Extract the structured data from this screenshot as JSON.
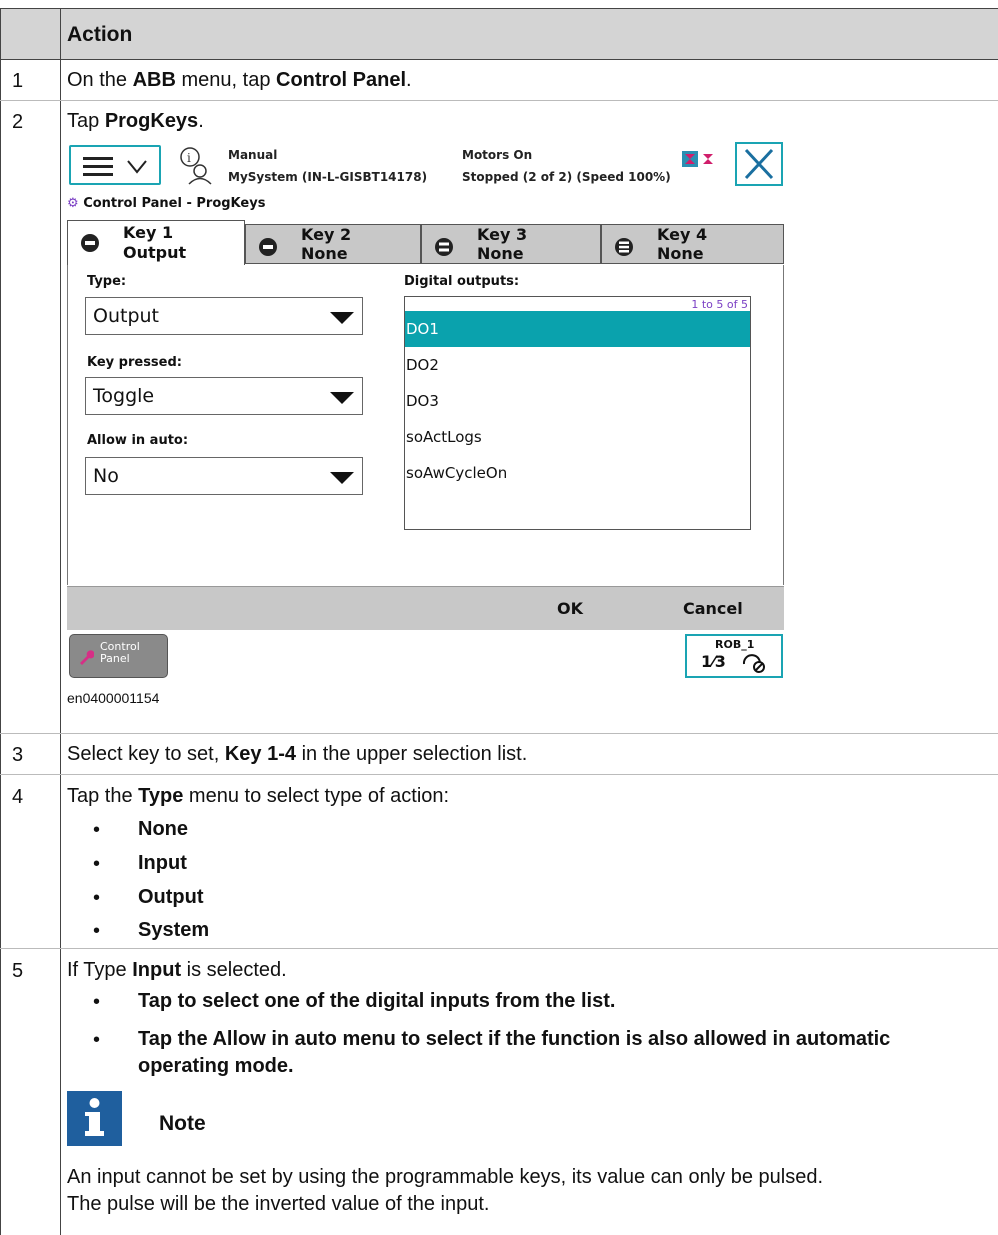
{
  "table": {
    "header": "Action",
    "rows": [
      {
        "num": "1",
        "text_pre": "On the ",
        "b1": "ABB",
        "text_mid": " menu, tap ",
        "b2": "Control Panel",
        "text_post": "."
      },
      {
        "num": "2",
        "text_pre": "Tap ",
        "b1": "ProgKeys",
        "text_post": "."
      },
      {
        "num": "3",
        "text_pre": "Select key to set, ",
        "b1": "Key 1-4",
        "text_post": " in the upper selection list."
      },
      {
        "num": "4",
        "text_pre": "Tap the ",
        "b1": "Type",
        "text_post": " menu to select type of action:",
        "bullets": [
          "None",
          "Input",
          "Output",
          "System"
        ]
      },
      {
        "num": "5",
        "text_pre": "If Type ",
        "b1": "Input",
        "text_post": " is selected.",
        "bullet1": "Tap to select one of the digital inputs from the list.",
        "bullet2_pre": "Tap the ",
        "bullet2_b": "Allow in auto",
        "bullet2_post": " menu to select if the function is also allowed in automatic",
        "bullet2_line2": "operating mode.",
        "note_title": "Note",
        "note_line1": "An input cannot be set by using the programmable keys, its value can only be pulsed.",
        "note_line2": "The pulse will be the inverted value of the input."
      }
    ]
  },
  "pendant": {
    "mode": "Manual",
    "system": "MySystem (IN-L-GISBT14178)",
    "motors": "Motors On",
    "run_state": "Stopped (2 of 2) (Speed 100%)",
    "title": "Control Panel - ProgKeys",
    "tabs": [
      {
        "line1": "Key 1",
        "line2": "Output"
      },
      {
        "line1": "Key 2",
        "line2": "None"
      },
      {
        "line1": "Key 3",
        "line2": "None"
      },
      {
        "line1": "Key 4",
        "line2": "None"
      }
    ],
    "type_label": "Type:",
    "type_value": "Output",
    "key_pressed_label": "Key pressed:",
    "key_pressed_value": "Toggle",
    "allow_auto_label": "Allow in auto:",
    "allow_auto_value": "No",
    "outputs_label": "Digital outputs:",
    "outputs_count": "1 to 5 of 5",
    "outputs": [
      "DO1",
      "DO2",
      "DO3",
      "soActLogs",
      "soAwCycleOn"
    ],
    "ok_label": "OK",
    "cancel_label": "Cancel",
    "cp_line1": "Control",
    "cp_line2": "Panel",
    "rob_label": "ROB_1",
    "rob_fraction": "1⁄3",
    "accent": "#1aa4b3",
    "selected_color": "#0aa2ad"
  },
  "caption": "en0400001154"
}
